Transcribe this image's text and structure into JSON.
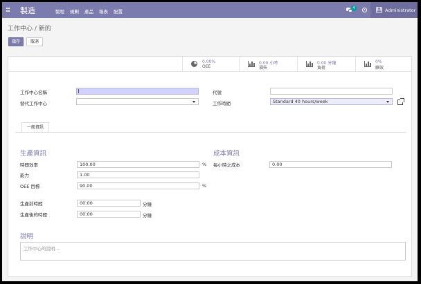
{
  "nav": {
    "brand": "製造",
    "menu": [
      "製程",
      "規劃",
      "產品",
      "報表",
      "配置"
    ],
    "chat_count": "4",
    "user": "Administrator"
  },
  "control": {
    "breadcrumb": "工作中心 / 新的",
    "save_label": "儲存",
    "discard_label": "取消"
  },
  "stats": [
    {
      "value": "0.00%",
      "label": "OEE",
      "icon": "pie-chart-icon"
    },
    {
      "value": "0.00 小時",
      "label": "損失",
      "icon": "bar-chart-icon"
    },
    {
      "value": "0.00 分鐘",
      "label": "負荷",
      "icon": "bar-chart-icon"
    },
    {
      "value": "0%",
      "label": "績效",
      "icon": "bar-chart-icon"
    }
  ],
  "form": {
    "name_label": "工作中心名稱",
    "name_value": "",
    "alt_label": "替代工作中心",
    "alt_value": "",
    "code_label": "代號",
    "code_value": "",
    "hours_label": "工作時間",
    "hours_value": "Standard 40 hours/week"
  },
  "tab": {
    "label": "一般資訊"
  },
  "production": {
    "title": "生產資訊",
    "efficiency_label": "時間效率",
    "efficiency_value": "100.00",
    "capacity_label": "能力",
    "capacity_value": "1.00",
    "oee_label": "OEE 目標",
    "oee_value": "90.00",
    "percent": "%",
    "setup_label": "生產前時間",
    "setup_value": "00:00",
    "cleanup_label": "生產後的時間",
    "cleanup_value": "00:00",
    "minutes": "分鐘"
  },
  "cost": {
    "title": "成本資訊",
    "hour_cost_label": "每小時之成本",
    "hour_cost_value": "0.00"
  },
  "description": {
    "title": "說明",
    "placeholder": "工作中心的說明..."
  },
  "colors": {
    "accent": "#7c7bad",
    "required": "#d2d2ff",
    "badge": "#00a09d"
  }
}
